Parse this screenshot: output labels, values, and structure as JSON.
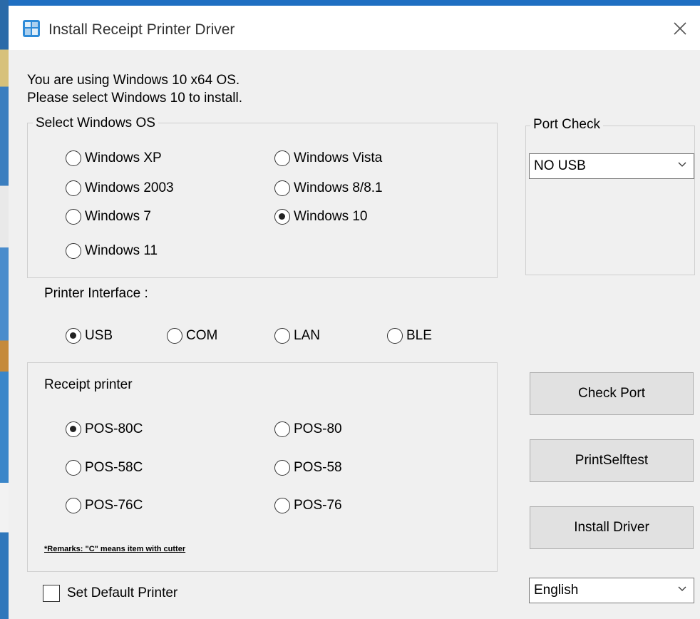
{
  "window": {
    "title": "Install Receipt Printer Driver"
  },
  "info": {
    "line1": "You are using Windows 10 x64 OS.",
    "line2": "Please select Windows 10 to install."
  },
  "os_group": {
    "legend": "Select Windows OS",
    "options": [
      {
        "label": "Windows XP",
        "selected": false
      },
      {
        "label": "Windows Vista",
        "selected": false
      },
      {
        "label": "Windows 2003",
        "selected": false
      },
      {
        "label": "Windows 8/8.1",
        "selected": false
      },
      {
        "label": "Windows 7",
        "selected": false
      },
      {
        "label": "Windows 10",
        "selected": true
      },
      {
        "label": "Windows 11",
        "selected": false
      }
    ]
  },
  "port_check": {
    "legend": "Port Check",
    "selected": "NO USB"
  },
  "interface": {
    "label": "Printer Interface :",
    "options": [
      {
        "label": "USB",
        "selected": true
      },
      {
        "label": "COM",
        "selected": false
      },
      {
        "label": "LAN",
        "selected": false
      },
      {
        "label": "BLE",
        "selected": false
      }
    ]
  },
  "printer_group": {
    "label": "Receipt printer",
    "options": [
      {
        "label": "POS-80C",
        "selected": true
      },
      {
        "label": "POS-80",
        "selected": false
      },
      {
        "label": "POS-58C",
        "selected": false
      },
      {
        "label": "POS-58",
        "selected": false
      },
      {
        "label": "POS-76C",
        "selected": false
      },
      {
        "label": "POS-76",
        "selected": false
      }
    ],
    "remark": "*Remarks: \"C\" means item with cutter"
  },
  "buttons": {
    "check_port": "Check Port",
    "print_selftest": "PrintSelftest",
    "install_driver": "Install Driver"
  },
  "default_printer": {
    "label": "Set Default Printer",
    "checked": false
  },
  "language": {
    "selected": "English"
  },
  "icons": {
    "app": "printer-app-icon",
    "close": "close-icon",
    "dropdown": "chevron-down-icon"
  }
}
